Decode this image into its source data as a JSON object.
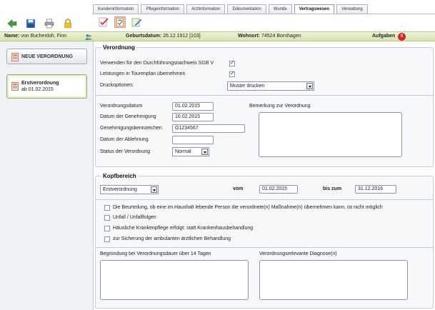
{
  "toolbar": {
    "icons": [
      "arrow-left-icon",
      "save-icon",
      "print-icon",
      "lock-icon"
    ],
    "tabs": [
      {
        "label": "Kundeninformation"
      },
      {
        "label": "Pflegeinformation"
      },
      {
        "label": "Arztinformation"
      },
      {
        "label": "Dokumentation"
      },
      {
        "label": "Wunde"
      },
      {
        "label": "Vertragswesen",
        "active": true
      },
      {
        "label": "Verwaltung"
      }
    ],
    "sub_icons": [
      "checklist-icon",
      "prescription-icon",
      "edit-document-icon"
    ]
  },
  "patient": {
    "name_label": "Name:",
    "name_value": "von Buchenloh, Finn",
    "birth_label": "Geburtsdatum:",
    "birth_value": "26.12.1912 [103]",
    "address_label": "Wohnort:",
    "address_value": "74524 Bornhagen",
    "tasks_label": "Aufgaben",
    "tasks_count": "0"
  },
  "sidebar": {
    "new_button": "NEUE VERORDNUNG",
    "items": [
      {
        "title": "Erstverordnung",
        "subtitle": "ab 01.02.2015"
      }
    ]
  },
  "verordnung": {
    "title": "Verordnung",
    "sgb_label": "Verwenden für den Durchführungsnachweis SGB V",
    "sgb_checked": true,
    "tour_label": "Leistungen in Tourenplan übernehmen",
    "tour_checked": true,
    "print_label": "Druckoptionen:",
    "print_value": "Muster drucken",
    "date_label": "Verordnungsdatum",
    "date_value": "01.02.2015",
    "approval_label": "Datum der Genehmigung",
    "approval_value": "10.02.2015",
    "approval_id_label": "Genehmigungskennzeichen",
    "approval_id_value": "G1234567",
    "rejection_label": "Datum der Ablehnung",
    "rejection_value": "",
    "status_label": "Status der Verordnung",
    "status_value": "Normal",
    "remark_label": "Bemerkung zur Verordnung",
    "remark_value": ""
  },
  "kopfbereich": {
    "title": "Kopfbereich",
    "type_value": "Erstverordnung",
    "from_label": "vom",
    "from_value": "01.02.2015",
    "to_label": "bis zum",
    "to_value": "31.12.2016",
    "checks": [
      {
        "label": "Die Beurteilung, ob eine im Haushalt lebende Person die verordnete(n) Maßnahme(n) übernehmen kann, ist nicht möglich",
        "checked": false
      },
      {
        "label": "Unfall / Unfallfolgen",
        "checked": false
      },
      {
        "label": "Häusliche Krankenpflege erfolgt: statt Krankenhausbehandlung",
        "checked": false
      },
      {
        "label": "zur Sicherung der ambulanten ärztlichen Behandlung",
        "checked": false
      }
    ],
    "reason_label": "Begründung bei Verordnungsdauer über 14 Tagen",
    "reason_value": "",
    "diagnosis_label": "Verordnungsrelevante Diagnose(n)",
    "diagnosis_value": ""
  }
}
